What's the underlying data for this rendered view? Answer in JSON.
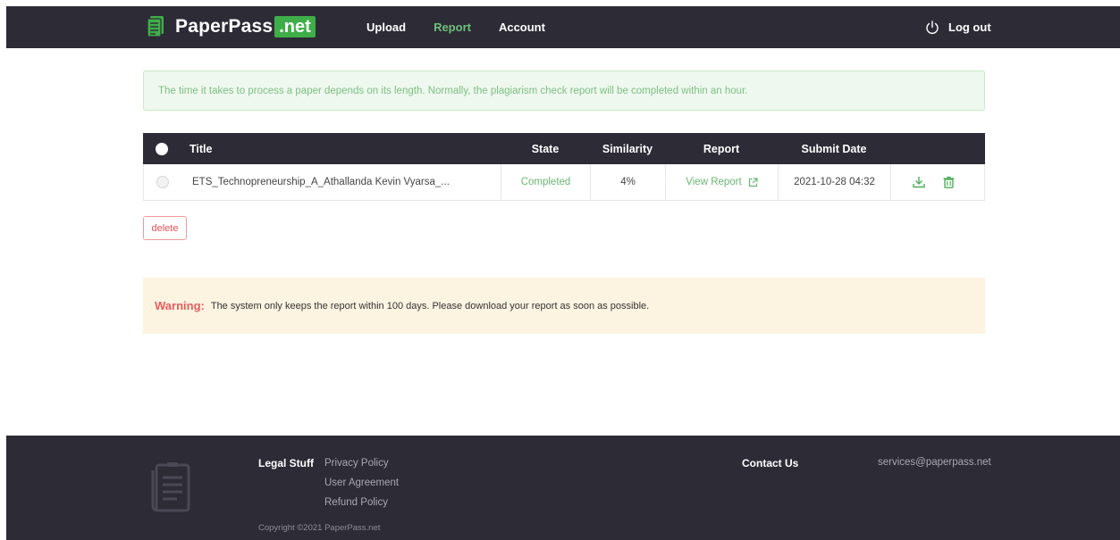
{
  "header": {
    "brand_name": "PaperPass",
    "brand_tld": ".net",
    "nav": [
      {
        "label": "Upload",
        "active": false
      },
      {
        "label": "Report",
        "active": true
      },
      {
        "label": "Account",
        "active": false
      }
    ],
    "logout_label": "Log out"
  },
  "info_banner": "The time it takes to process a paper depends on its length. Normally, the plagiarism check report will be completed within an hour.",
  "table": {
    "columns": [
      "Title",
      "State",
      "Similarity",
      "Report",
      "Submit Date"
    ],
    "rows": [
      {
        "title": "ETS_Technopreneurship_A_Athallanda Kevin Vyarsa_...",
        "state": "Completed",
        "similarity": "4%",
        "report": "View Report",
        "submit_date": "2021-10-28 04:32"
      }
    ]
  },
  "delete_label": "delete",
  "warning": {
    "label": "Warning:",
    "text": "The system only keeps the report within 100 days. Please download your report as soon as possible."
  },
  "footer": {
    "legal_title": "Legal Stuff",
    "legal_links": [
      "Privacy Policy",
      "User Agreement",
      "Refund Policy"
    ],
    "copyright": "Copyright ©2021 PaperPass.net",
    "contact_title": "Contact Us",
    "contact_email": "services@paperpass.net"
  },
  "colors": {
    "header_bg": "#2d2b36",
    "accent_green": "#3fae49",
    "link_green": "#6bb573",
    "danger_red": "#e25454",
    "warning_bg": "#fcf3e1",
    "info_bg": "#eef8ee"
  },
  "icons": {
    "brand": "document-icon",
    "logout": "power-icon",
    "external_link": "external-link-icon",
    "download": "download-icon",
    "delete": "trash-icon",
    "footer_logo": "document-stack-icon"
  }
}
